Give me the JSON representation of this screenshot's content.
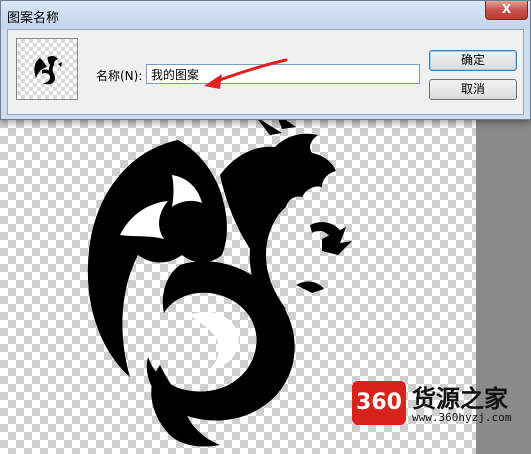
{
  "dialog": {
    "title": "图案名称",
    "close_label": "X",
    "name_label": "名称(N):",
    "name_value": "我的图案",
    "ok_label": "确定",
    "cancel_label": "取消"
  },
  "icons": {
    "preview": "dragon-thumbnail-icon",
    "arrow": "red-arrow-icon",
    "artwork": "tribal-dragon-artwork"
  },
  "watermark": {
    "badge": "360",
    "name": "货源之家",
    "url": "www.360hyzj.com"
  },
  "colors": {
    "arrow": "#e0201c",
    "watermark_badge": "#d9221c"
  }
}
